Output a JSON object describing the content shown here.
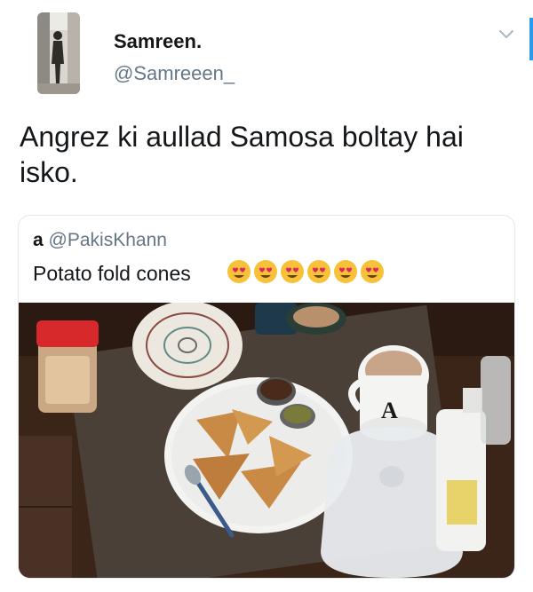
{
  "tweet": {
    "display_name": "Samreen.",
    "handle": "@Samreeen_",
    "text": "Angrez ki aullad Samosa boltay hai isko."
  },
  "quote": {
    "author_name": "a",
    "author_handle": "@PakisKhann",
    "text": "Potato fold cones",
    "emoji": [
      "heart-eyes",
      "heart-eyes",
      "heart-eyes",
      "heart-eyes",
      "heart-eyes",
      "heart-eyes"
    ]
  },
  "icons": {
    "menu": "chevron-down-icon"
  },
  "colors": {
    "accent": "#2b9be9",
    "handle_gray": "#657786",
    "text": "#14171a",
    "border": "#e1e8ed"
  }
}
